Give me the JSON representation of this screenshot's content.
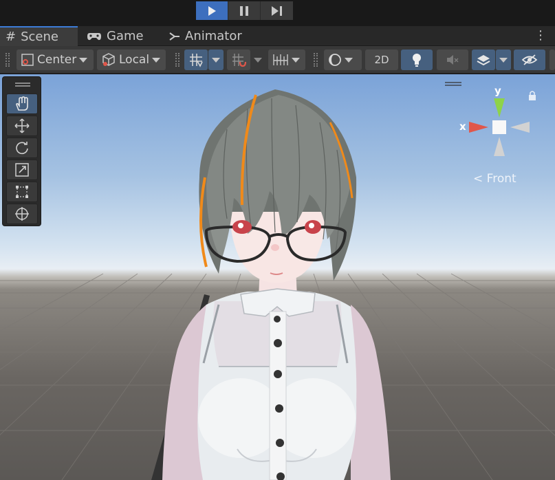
{
  "playbar": {
    "play_icon": "play-icon",
    "pause_icon": "pause-icon",
    "step_icon": "step-icon",
    "accent": "#3d6fbe"
  },
  "tabs": [
    {
      "label": "Scene",
      "icon": "grid-hash-icon"
    },
    {
      "label": "Game",
      "icon": "gamepad-icon"
    },
    {
      "label": "Animator",
      "icon": "animator-icon"
    }
  ],
  "toolbar": {
    "pivot_label": "Center",
    "space_label": "Local",
    "mode_2d_label": "2D"
  },
  "tools": [
    "hand-tool",
    "move-tool",
    "rotate-tool",
    "scale-tool",
    "rect-tool",
    "transform-tool"
  ],
  "gizmo": {
    "y_label": "y",
    "x_label": "x",
    "view_label": "Front",
    "colors": {
      "x": "#e0574a",
      "y": "#8ed34a",
      "z": "#d0d0d0"
    }
  }
}
